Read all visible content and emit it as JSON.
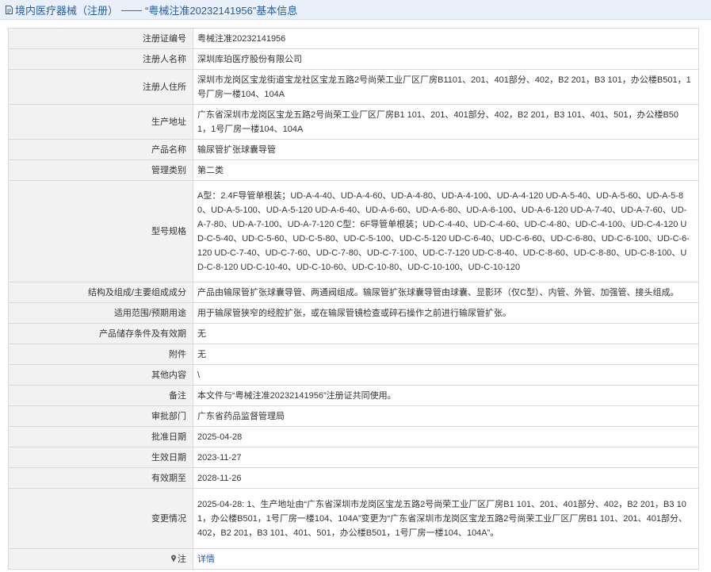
{
  "header": {
    "category": "境内医疗器械（注册）",
    "separator": "——",
    "title": "“粤械注准20232141956”基本信息"
  },
  "rows": [
    {
      "label": "注册证编号",
      "value": "粤械注准20232141956"
    },
    {
      "label": "注册人名称",
      "value": "深圳库珀医疗股份有限公司"
    },
    {
      "label": "注册人住所",
      "value": "深圳市龙岗区宝龙街道宝龙社区宝龙五路2号尚荣工业厂区厂房B1101、201、401部分、402，B2 201，B3 101，办公楼B501，1号厂房一楼104、104A"
    },
    {
      "label": "生产地址",
      "value": "广东省深圳市龙岗区宝龙五路2号尚荣工业厂区厂房B1 101、201、401部分、402，B2 201，B3 101、401、501，办公楼B501，1号厂房一楼104、104A"
    },
    {
      "label": "产品名称",
      "value": "输尿管扩张球囊导管"
    },
    {
      "label": "管理类别",
      "value": "第二类"
    },
    {
      "label": "型号规格",
      "value": "A型：2.4F导管单根装；UD-A-4-40、UD-A-4-60、UD-A-4-80、UD-A-4-100、UD-A-4-120 UD-A-5-40、UD-A-5-60、UD-A-5-80、UD-A-5-100、UD-A-5-120 UD-A-6-40、UD-A-6-60、UD-A-6-80、UD-A-6-100、UD-A-6-120 UD-A-7-40、UD-A-7-60、UD-A-7-80、UD-A-7-100、UD-A-7-120 C型：6F导管单根装；UD-C-4-40、UD-C-4-60、UD-C-4-80、UD-C-4-100、UD-C-4-120 UD-C-5-40、UD-C-5-60、UD-C-5-80、UD-C-5-100、UD-C-5-120 UD-C-6-40、UD-C-6-60、UD-C-6-80、UD-C-6-100、UD-C-6-120 UD-C-7-40、UD-C-7-60、UD-C-7-80、UD-C-7-100、UD-C-7-120 UD-C-8-40、UD-C-8-60、UD-C-8-80、UD-C-8-100、UD-C-8-120 UD-C-10-40、UD-C-10-60、UD-C-10-80、UD-C-10-100、UD-C-10-120"
    },
    {
      "label": "结构及组成/主要组成成分",
      "value": "产品由输尿管扩张球囊导管、两通阀组成。输尿管扩张球囊导管由球囊、显影环（仅C型）、内管、外管、加强管、接头组成。"
    },
    {
      "label": "适用范围/预期用途",
      "value": "用于输尿管狭窄的经腔扩张，或在输尿管镜检查或碎石操作之前进行输尿管扩张。"
    },
    {
      "label": "产品储存条件及有效期",
      "value": "无"
    },
    {
      "label": "附件",
      "value": "无"
    },
    {
      "label": "其他内容",
      "value": "\\"
    },
    {
      "label": "备注",
      "value": "本文件与“粤械注准20232141956”注册证共同使用。"
    },
    {
      "label": "审批部门",
      "value": "广东省药品监督管理局"
    },
    {
      "label": "批准日期",
      "value": "2025-04-28"
    },
    {
      "label": "生效日期",
      "value": "2023-11-27"
    },
    {
      "label": "有效期至",
      "value": "2028-11-26"
    },
    {
      "label": "变更情况",
      "value": "2025-04-28: 1、生产地址由“广东省深圳市龙岗区宝龙五路2号尚荣工业厂区厂房B1 101、201、401部分、402，B2 201，B3 101，办公楼B501，1号厂房一楼104、104A”变更为“广东省深圳市龙岗区宝龙五路2号尚荣工业厂区厂房B1 101、201、401部分、402，B2 201，B3 101、401、501，办公楼B501，1号厂房一楼104、104A”。"
    }
  ],
  "note_row": {
    "label": "注",
    "link_text": "详情"
  },
  "icons": {
    "header": "document-icon",
    "note": "pin-icon"
  },
  "colors": {
    "link": "#1f5da8",
    "label_bg": "#f2f2f2",
    "border": "#d9d9d9",
    "header_bg": "#e9f0f9"
  }
}
